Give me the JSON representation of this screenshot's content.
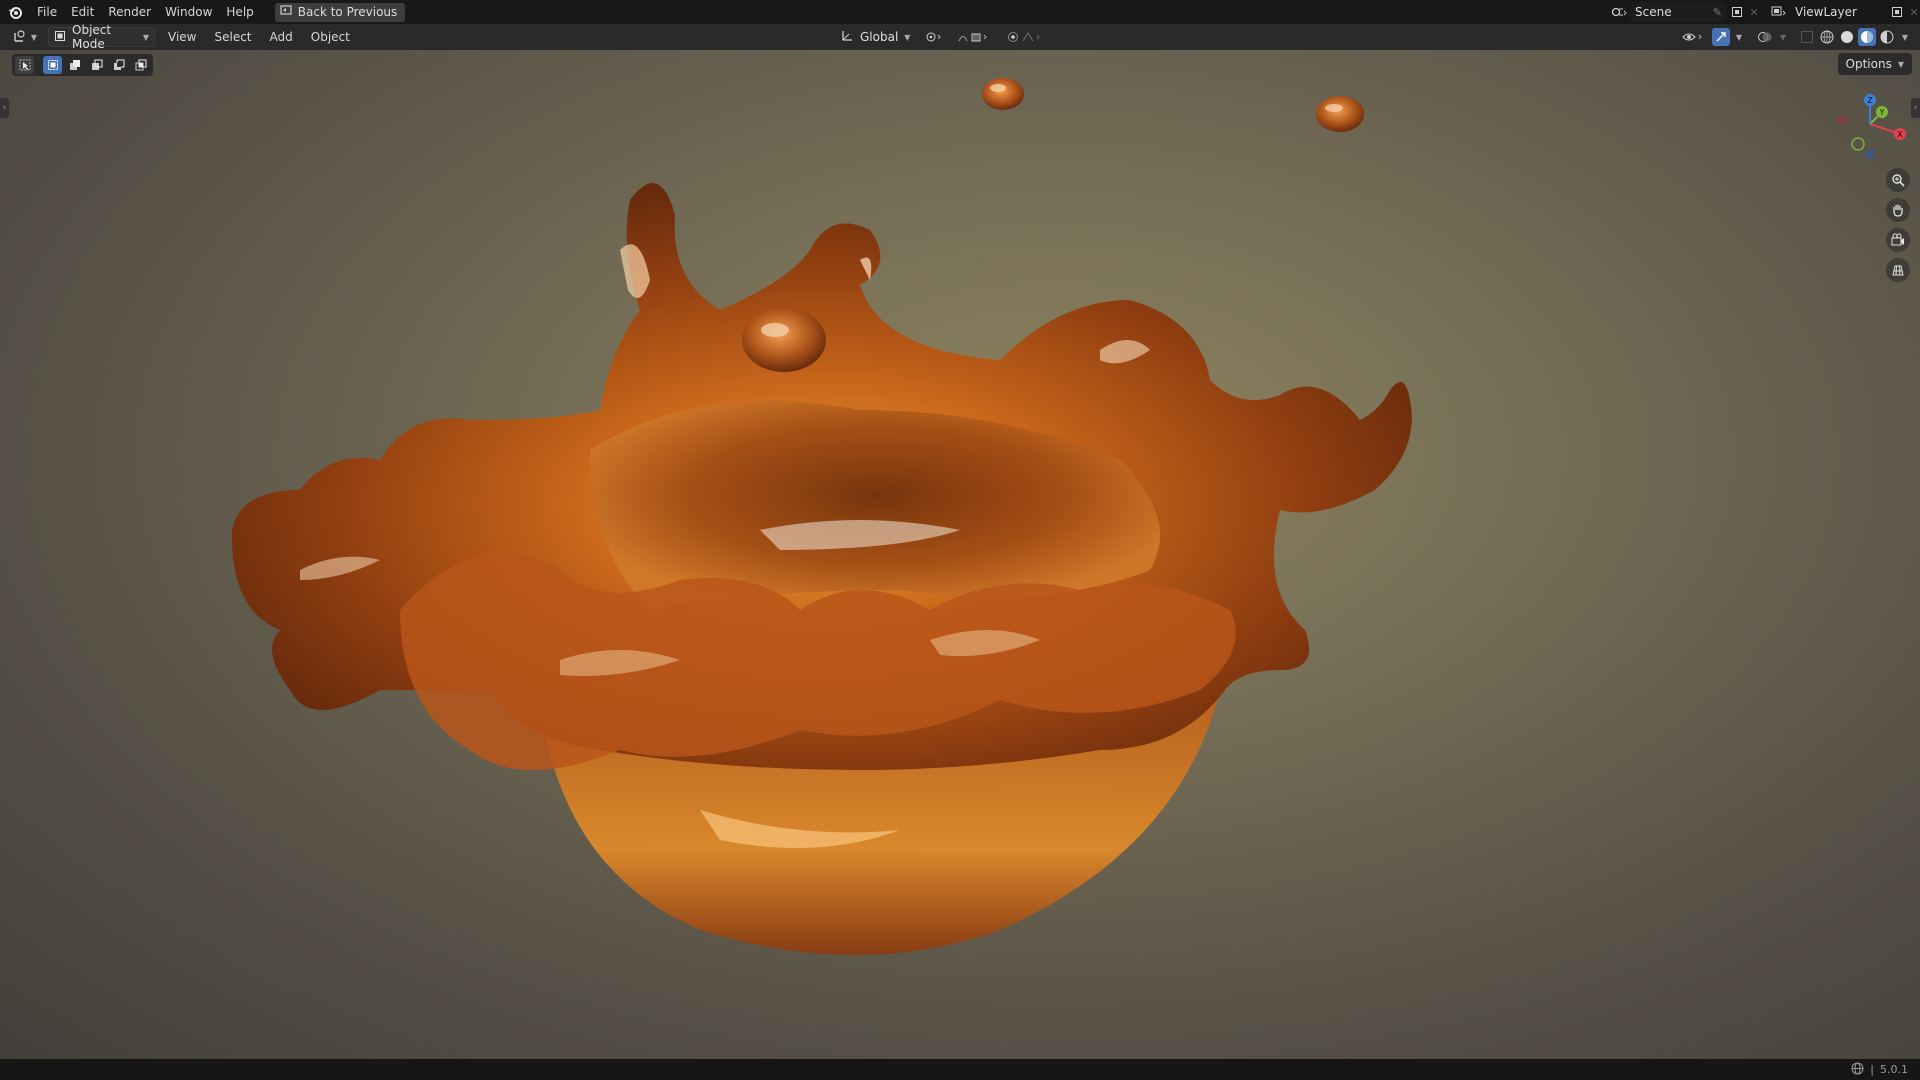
{
  "topbar": {
    "menus": [
      "File",
      "Edit",
      "Render",
      "Window",
      "Help"
    ],
    "back_button": "Back to Previous",
    "scene": "Scene",
    "view_layer": "ViewLayer"
  },
  "header": {
    "mode": "Object Mode",
    "menus": [
      "View",
      "Select",
      "Add",
      "Object"
    ],
    "transform_orientation": "Global"
  },
  "viewport": {
    "options_label": "Options",
    "object": "amber liquid splash crown mesh",
    "gizmo_axes": [
      "Z",
      "Y",
      "X"
    ],
    "colors": {
      "x_axis": "#e0424f",
      "y_axis": "#7fb43a",
      "z_axis": "#3e7fd8",
      "accent": "#4772b3"
    }
  },
  "statusbar": {
    "version": "5.0.1"
  }
}
